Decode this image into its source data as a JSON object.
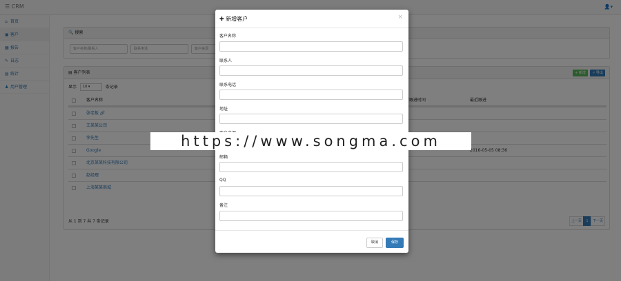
{
  "navbar": {
    "brand": "☰ CRM",
    "user_menu": "👤▾"
  },
  "sidebar": {
    "items": [
      {
        "icon": "⌂",
        "icon_name": "home-icon",
        "label": "首页"
      },
      {
        "icon": "▣",
        "icon_name": "customer-icon",
        "label": "客户"
      },
      {
        "icon": "▦",
        "icon_name": "report-icon",
        "label": "报告"
      },
      {
        "icon": "✎",
        "icon_name": "record-icon",
        "label": "日志"
      },
      {
        "icon": "▤",
        "icon_name": "stats-icon",
        "label": "统计"
      },
      {
        "icon": "♟",
        "icon_name": "users-icon",
        "label": "用户管理"
      }
    ]
  },
  "search": {
    "heading": "🔍 搜索",
    "name_placeholder": "客户名称/联系人",
    "phone_placeholder": "联系电话",
    "source_placeholder": "客户来源"
  },
  "list": {
    "heading": "▤ 客户列表",
    "add_label": "+ 新增",
    "export_label": "↗ 导出",
    "show_label": "显示",
    "page_size": "10",
    "records_label": "条记录",
    "col_name": "客户名称",
    "col_time": "最新跟进时间",
    "col_last": "最近跟进",
    "rows": [
      {
        "name": "张老板 🔗",
        "time": "",
        "last": ""
      },
      {
        "name": "王某某公司",
        "time": "",
        "last": ""
      },
      {
        "name": "李先生",
        "time": "",
        "last": ""
      },
      {
        "name": "Google",
        "time": "?",
        "last": "2016-05-05 08:36"
      },
      {
        "name": "北京某某科技有限公司",
        "time": "",
        "last": ""
      },
      {
        "name": "赵经理",
        "time": "",
        "last": ""
      },
      {
        "name": "上海某某商城",
        "time": "?",
        "last": ""
      }
    ],
    "summary": "从 1 到 7 共 7 条记录",
    "pager": {
      "prev": "上一页",
      "page": "1",
      "next": "下一页"
    }
  },
  "modal": {
    "title": "✚ 新增客户",
    "close": "×",
    "fields": [
      {
        "label": "客户名称"
      },
      {
        "label": "联系人"
      },
      {
        "label": "联系电话"
      },
      {
        "label": "地址"
      },
      {
        "label": "客户来源"
      },
      {
        "label": "邮箱"
      },
      {
        "label": "QQ"
      },
      {
        "label": "备注"
      }
    ],
    "cancel_label": "取消",
    "save_label": "保存"
  },
  "watermark": "https://www.songma.com"
}
